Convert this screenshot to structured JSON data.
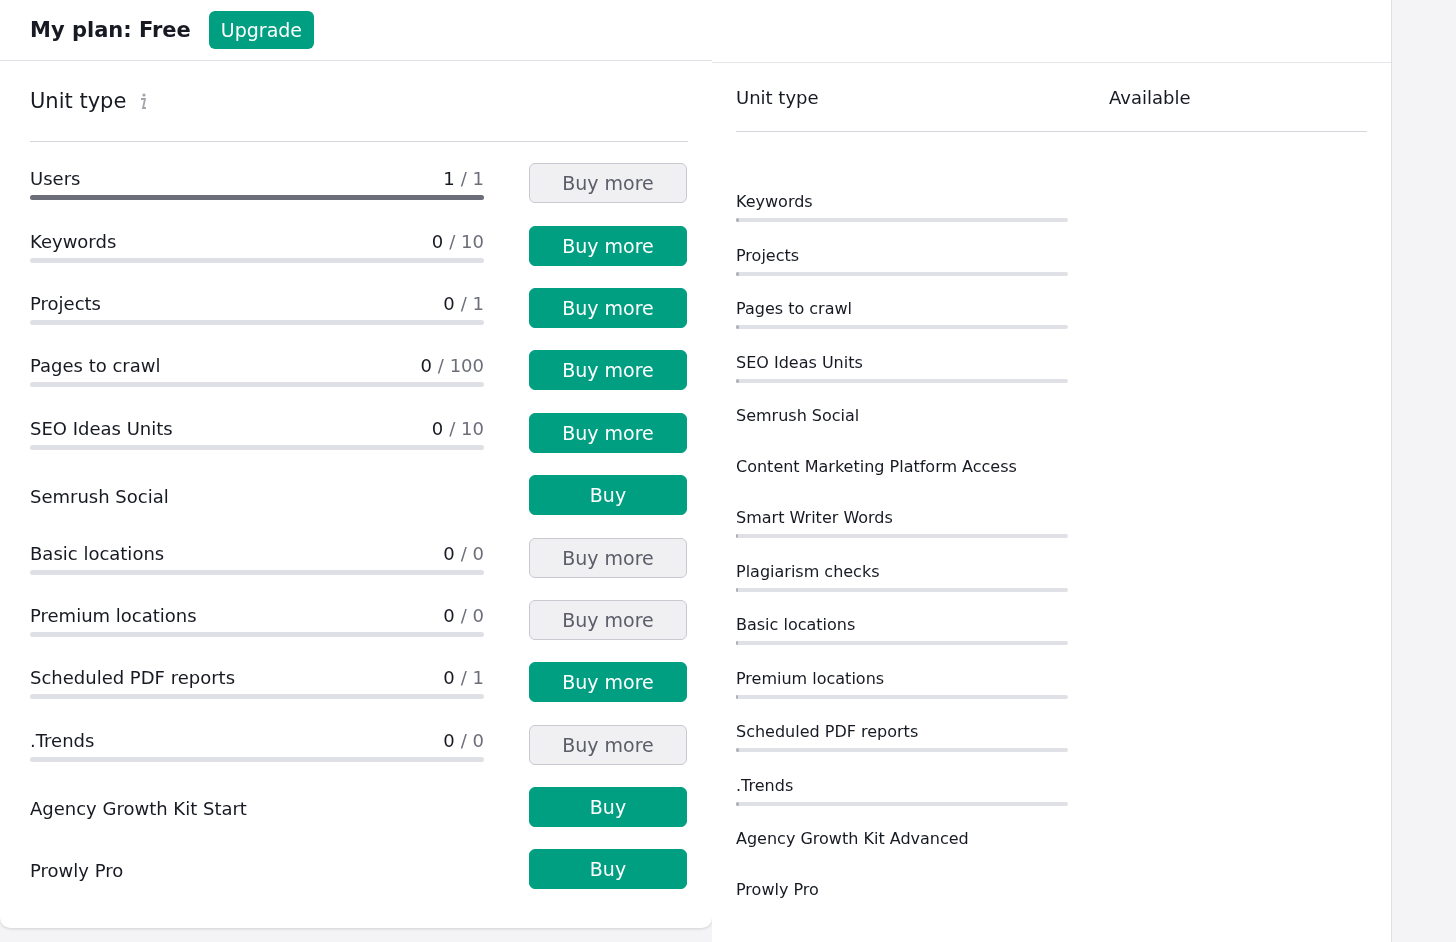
{
  "plan": {
    "title": "My plan: Free",
    "upgrade_button": "Upgrade"
  },
  "units": {
    "heading": "Unit type",
    "rows": [
      {
        "name": "Users",
        "used": "1",
        "limit": "/ 1",
        "level": 1,
        "button": "Buy more",
        "primary": false
      },
      {
        "name": "Keywords",
        "used": "0",
        "limit": "/ 10",
        "level": 0,
        "button": "Buy more",
        "primary": true
      },
      {
        "name": "Projects",
        "used": "0",
        "limit": "/ 1",
        "level": 0,
        "button": "Buy more",
        "primary": true
      },
      {
        "name": "Pages to crawl",
        "used": "0",
        "limit": "/ 100",
        "level": 0,
        "button": "Buy more",
        "primary": true
      },
      {
        "name": "SEO Ideas Units",
        "used": "0",
        "limit": "/ 10",
        "level": 0,
        "button": "Buy more",
        "primary": true
      },
      {
        "name": "Semrush Social",
        "button": "Buy",
        "primary": true
      },
      {
        "name": "Basic locations",
        "used": "0",
        "limit": "/ 0",
        "level": 0,
        "button": "Buy more",
        "primary": false
      },
      {
        "name": "Premium locations",
        "used": "0",
        "limit": "/ 0",
        "level": 0,
        "button": "Buy more",
        "primary": false
      },
      {
        "name": "Scheduled PDF reports",
        "used": "0",
        "limit": "/ 1",
        "level": 0,
        "button": "Buy more",
        "primary": true
      },
      {
        "name": ".Trends",
        "used": "0",
        "limit": "/ 0",
        "level": 0,
        "button": "Buy more",
        "primary": false
      },
      {
        "name": "Agency Growth Kit Start",
        "button": "Buy",
        "primary": true
      },
      {
        "name": "Prowly Pro",
        "button": "Buy",
        "primary": true
      }
    ]
  },
  "available": {
    "columns": [
      "Unit type",
      "Available"
    ],
    "rows": [
      {
        "name": "Keywords",
        "level": 0.01
      },
      {
        "name": "Projects",
        "level": 0.01
      },
      {
        "name": "Pages to crawl",
        "level": 0.01
      },
      {
        "name": "SEO Ideas Units",
        "level": 0.01
      },
      {
        "name": "Semrush Social"
      },
      {
        "name": "Content Marketing Platform Access"
      },
      {
        "name": "Smart Writer Words",
        "level": 0
      },
      {
        "name": "Plagiarism checks",
        "level": 0
      },
      {
        "name": "Basic locations",
        "level": 0
      },
      {
        "name": "Premium locations",
        "level": 0
      },
      {
        "name": "Scheduled PDF reports",
        "level": 0.01
      },
      {
        "name": ".Trends",
        "level": 0.01
      },
      {
        "name": "Agency Growth Kit Advanced"
      },
      {
        "name": "Prowly Pro"
      }
    ]
  }
}
